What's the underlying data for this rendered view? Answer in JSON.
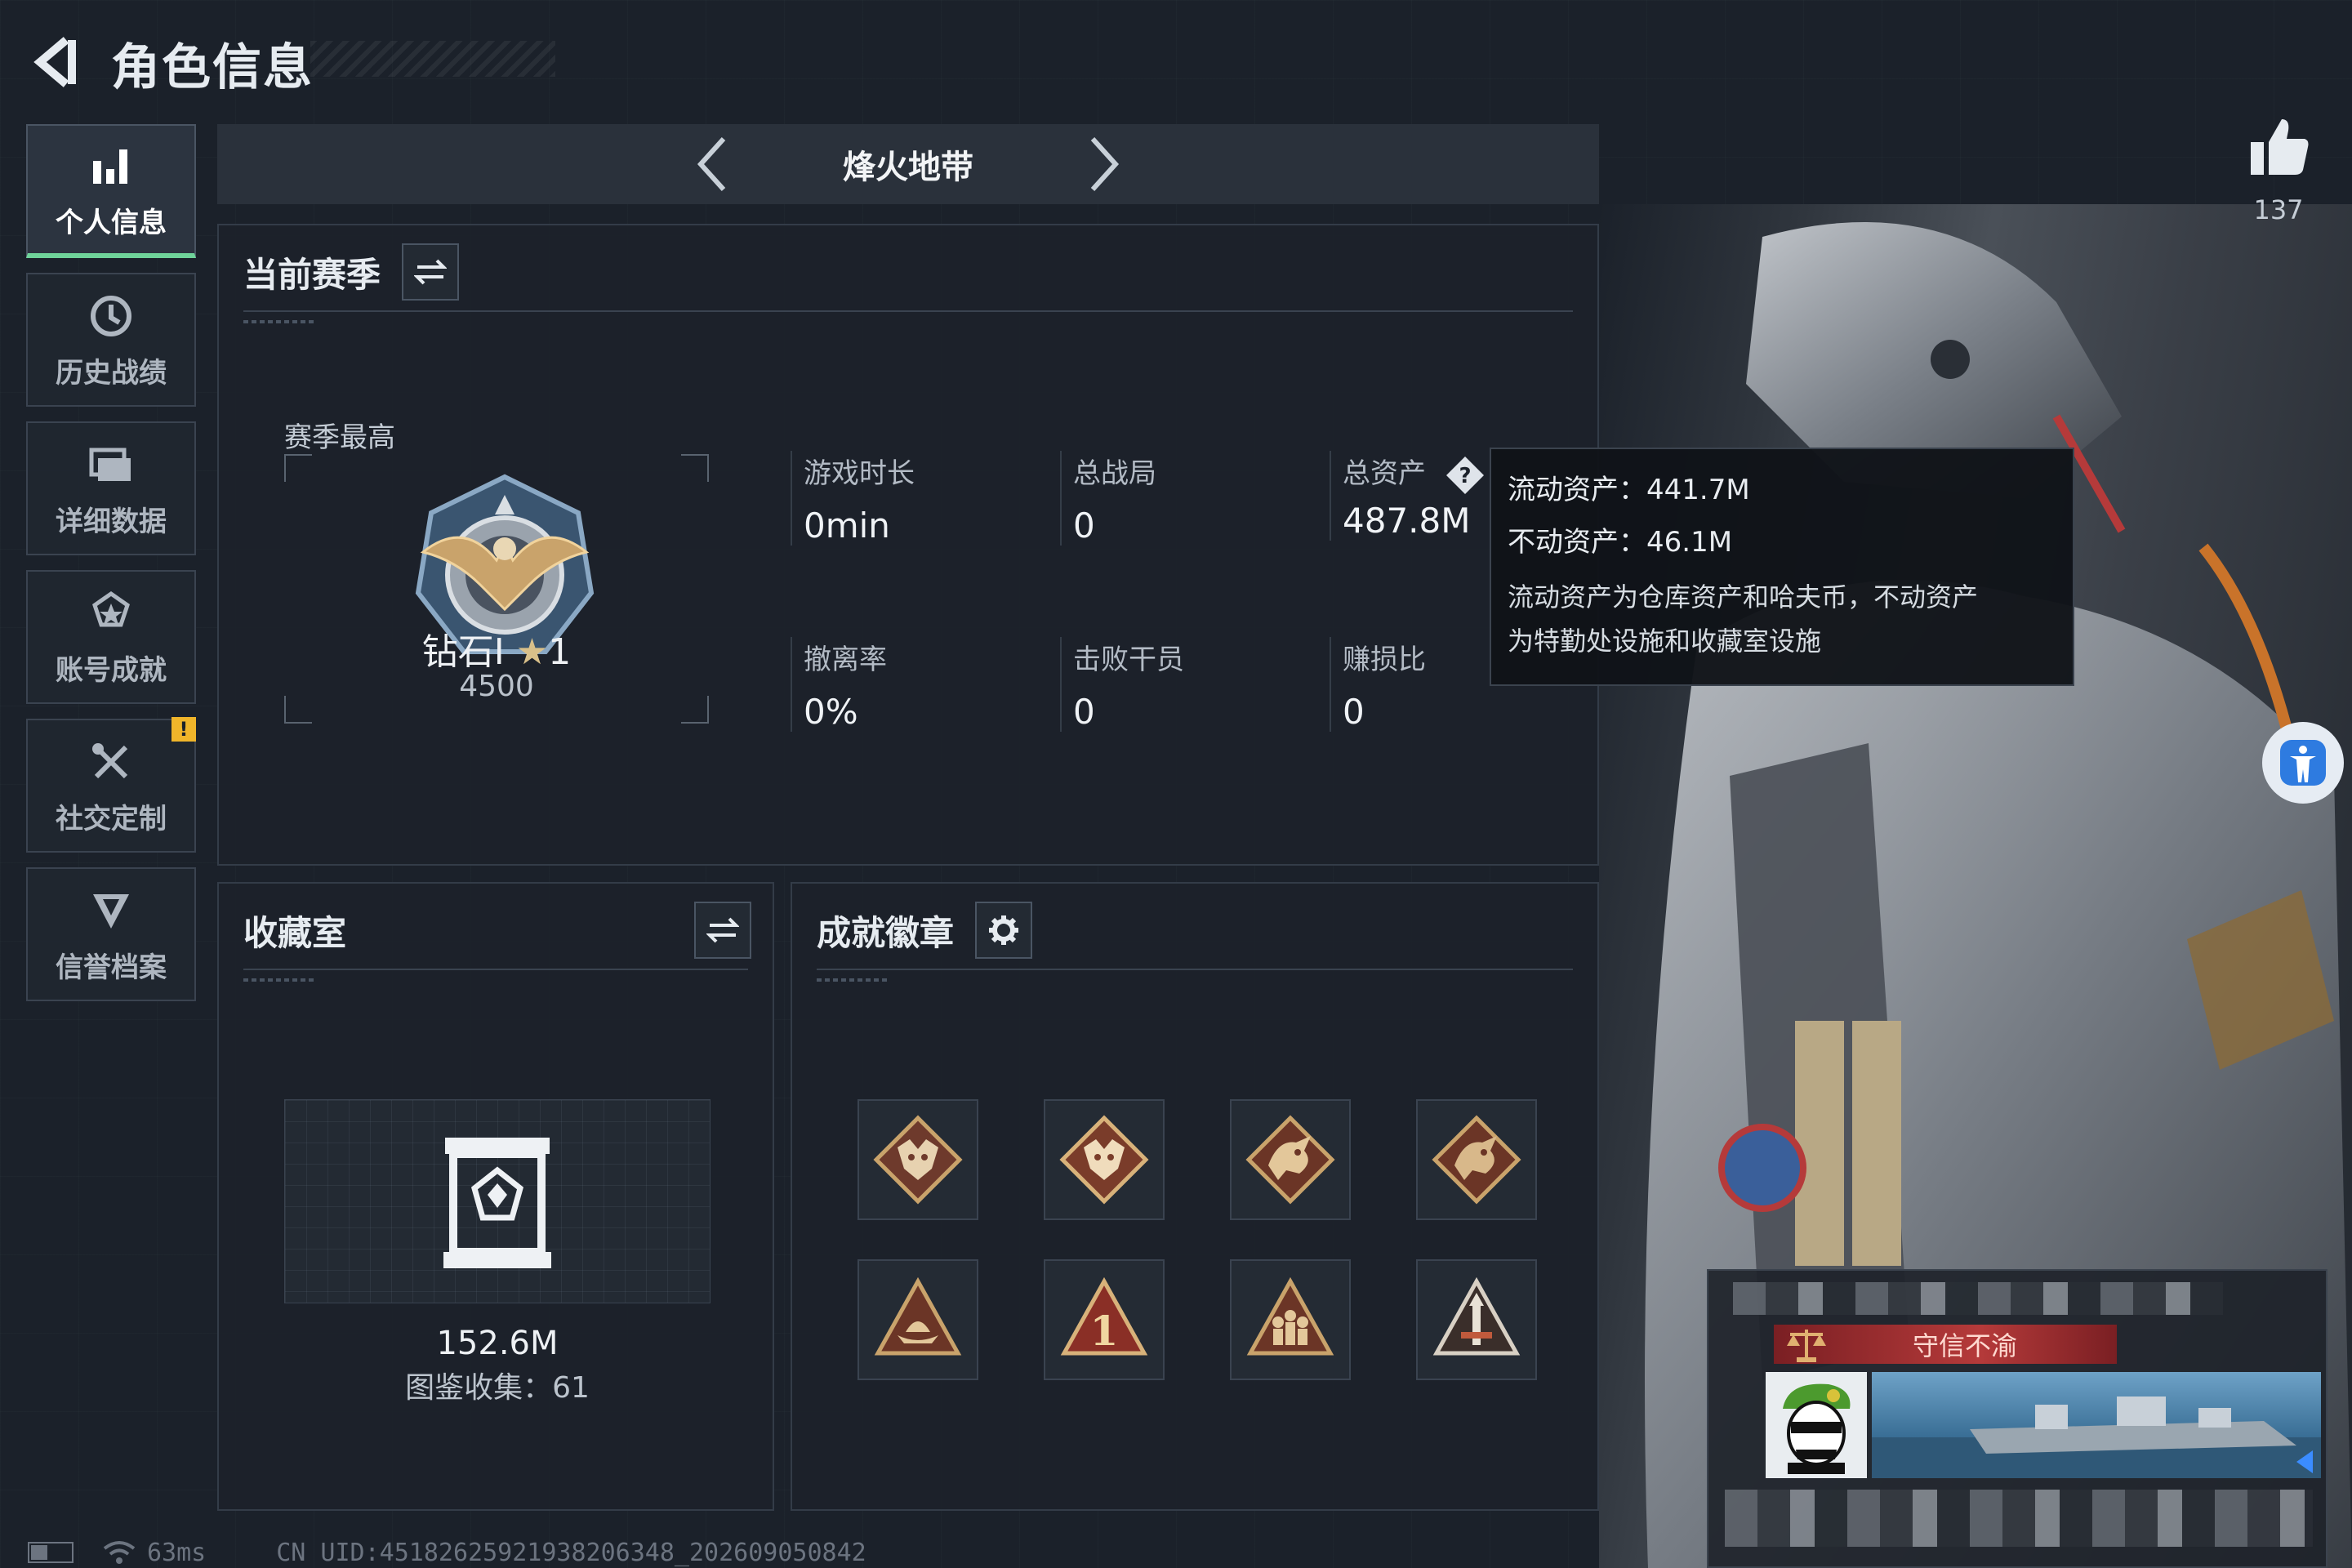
{
  "header": {
    "title": "角色信息"
  },
  "sidebar": {
    "items": [
      {
        "label": "个人信息",
        "icon": "bar-chart-icon",
        "active": true
      },
      {
        "label": "历史战绩",
        "icon": "clock-icon"
      },
      {
        "label": "详细数据",
        "icon": "folder-icon"
      },
      {
        "label": "账号成就",
        "icon": "achievement-icon"
      },
      {
        "label": "社交定制",
        "icon": "tools-icon",
        "badge": "!"
      },
      {
        "label": "信誉档案",
        "icon": "shield-icon"
      }
    ]
  },
  "mode": {
    "title": "烽火地带"
  },
  "season": {
    "title": "当前赛季",
    "best_label": "赛季最高",
    "rank_name": "钻石Ⅰ",
    "rank_stars": "1",
    "rank_score": "4500",
    "stats": {
      "play_time": {
        "label": "游戏时长",
        "value": "0min"
      },
      "total_matches": {
        "label": "总战局",
        "value": "0"
      },
      "total_assets": {
        "label": "总资产",
        "value": "487.8M"
      },
      "extract_rate": {
        "label": "撤离率",
        "value": "0%"
      },
      "kills": {
        "label": "击败干员",
        "value": "0"
      },
      "profit_ratio": {
        "label": "赚损比",
        "value": "0"
      }
    }
  },
  "tooltip": {
    "liquid": "流动资产：441.7M",
    "fixed": "不动资产：46.1M",
    "desc_line1": "流动资产为仓库资产和哈夫币，不动资产",
    "desc_line2": "为特勤处设施和收藏室设施"
  },
  "collection": {
    "title": "收藏室",
    "value": "152.6M",
    "count": "图鉴收集：61"
  },
  "achievements": {
    "title": "成就徽章",
    "badges": [
      "wolf-badge-icon",
      "wolf-badge-icon",
      "dragon-badge-icon",
      "dragon-badge-icon",
      "boat-badge-icon",
      "number-one-badge-icon",
      "squad-badge-icon",
      "tower-badge-icon"
    ]
  },
  "likes": {
    "count": "137"
  },
  "player_card": {
    "title": "守信不渝"
  },
  "status": {
    "ping": "63ms",
    "uid": "CN UID:4518262592193820634​8_202609050842"
  },
  "colors": {
    "accent_green": "#6fd39a",
    "background": "#1b212a",
    "panel": "#1c222a",
    "warning": "#f0b52a",
    "badge_gold": "#c9a36b",
    "title_red": "#b53a3a"
  }
}
